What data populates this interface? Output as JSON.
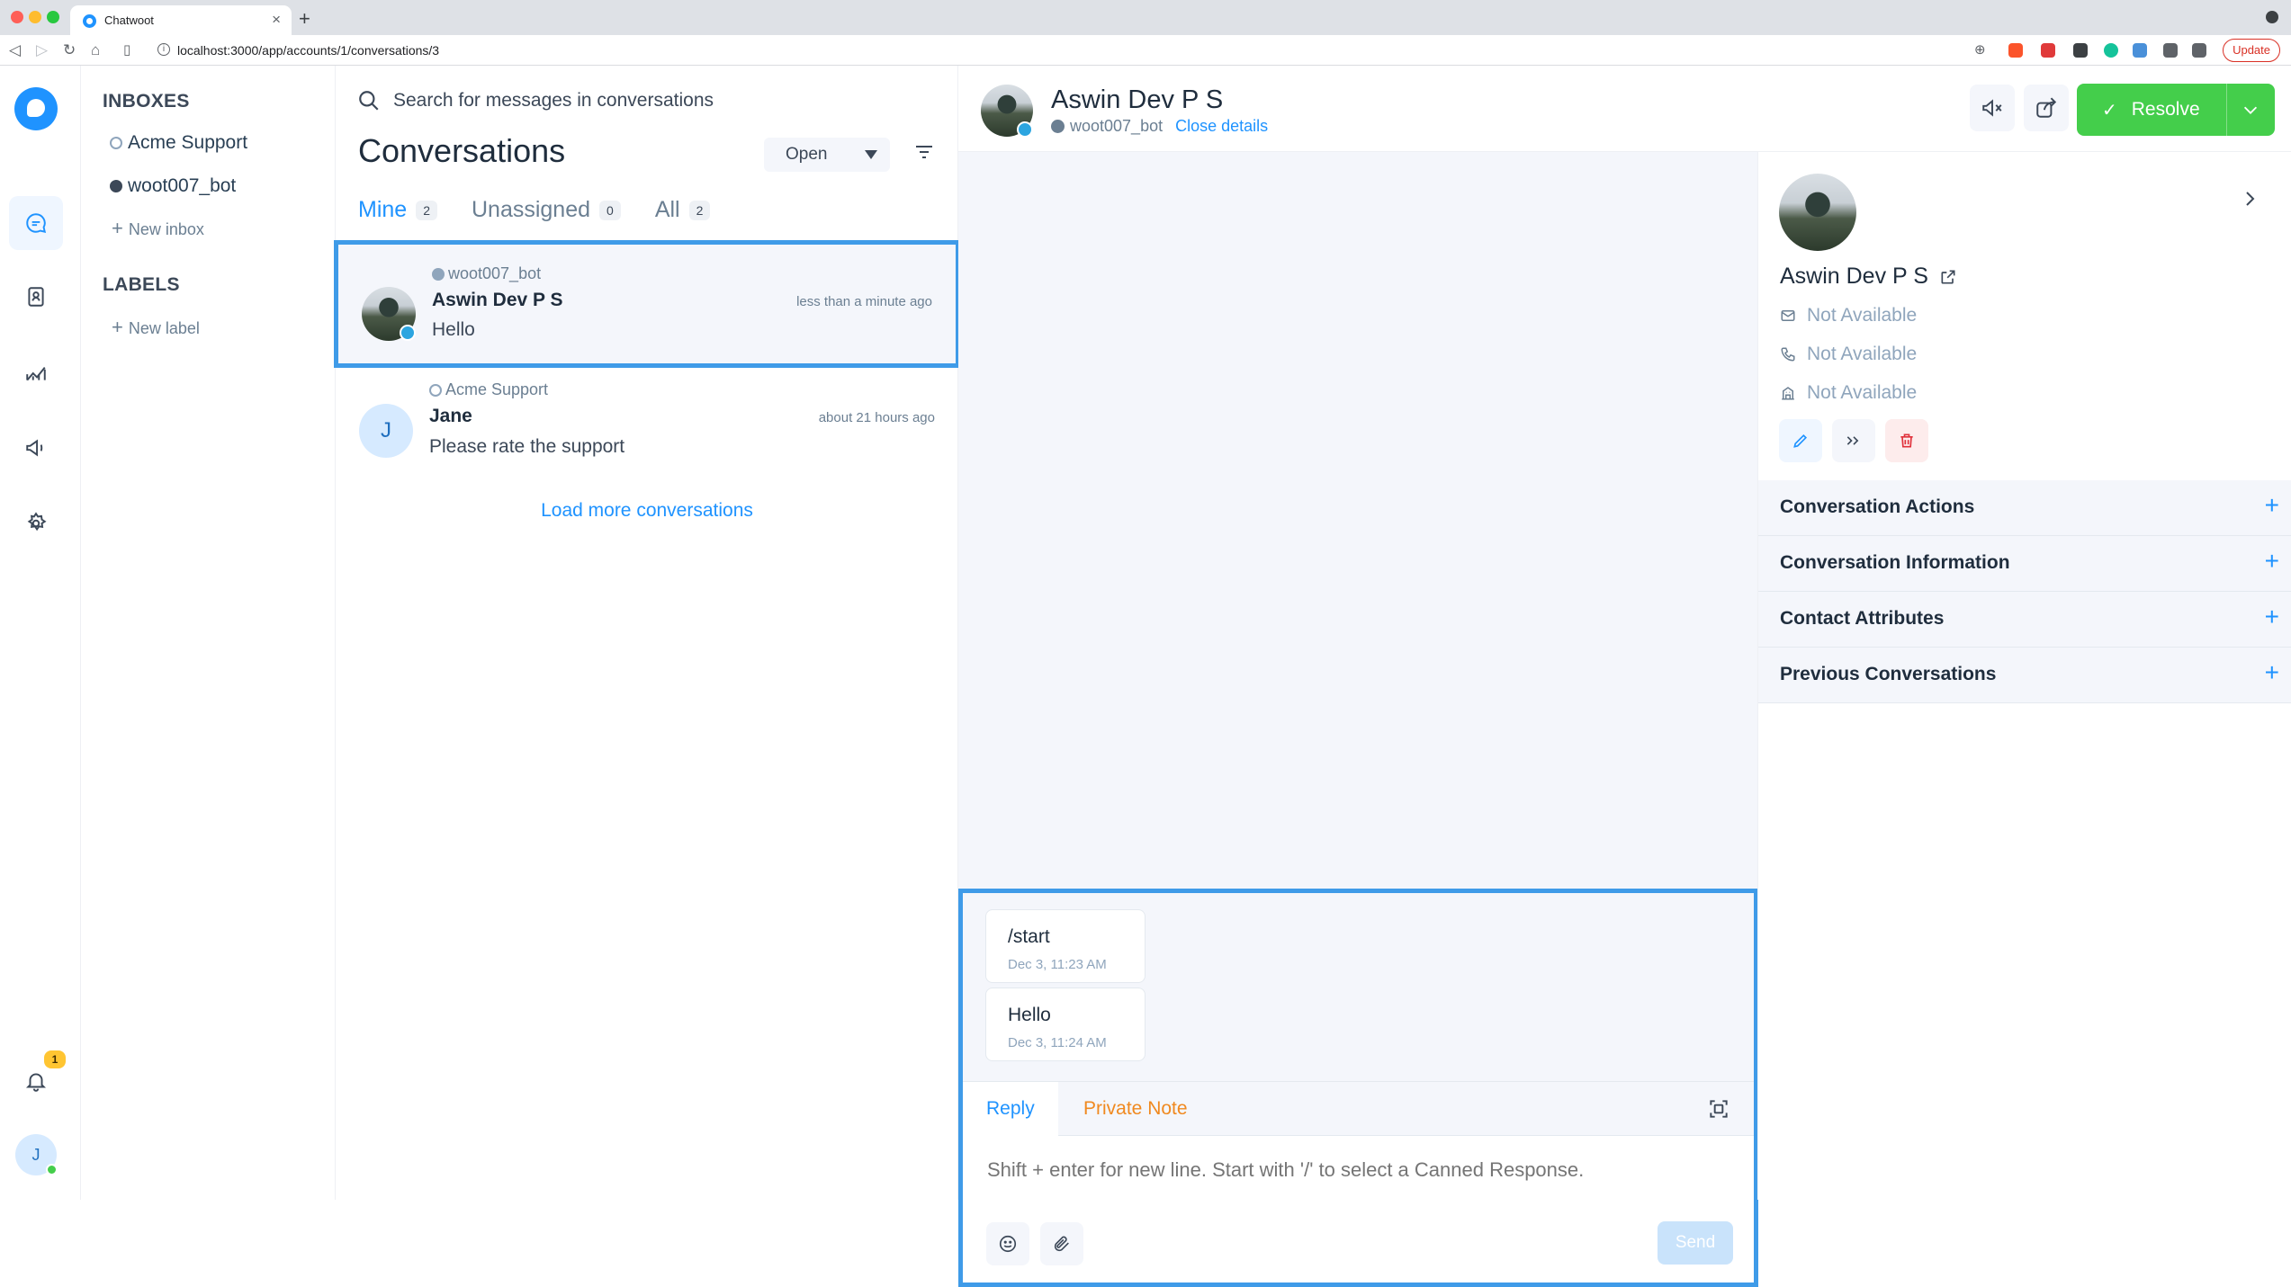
{
  "browser": {
    "tab_title": "Chatwoot",
    "url": "localhost:3000/app/accounts/1/conversations/3",
    "update_label": "Update"
  },
  "primary_nav": {
    "notification_count": "1",
    "user_initial": "J"
  },
  "secondary_nav": {
    "inboxes_heading": "INBOXES",
    "inboxes": [
      {
        "label": "Acme Support",
        "icon": "globe-icon"
      },
      {
        "label": "woot007_bot",
        "icon": "telegram-icon"
      }
    ],
    "new_inbox": "New inbox",
    "labels_heading": "LABELS",
    "new_label": "New label"
  },
  "conv_list": {
    "search_placeholder": "Search for messages in conversations",
    "title": "Conversations",
    "status_filter": "Open",
    "tabs": [
      {
        "label": "Mine",
        "count": "2",
        "active": true
      },
      {
        "label": "Unassigned",
        "count": "0",
        "active": false
      },
      {
        "label": "All",
        "count": "2",
        "active": false
      }
    ],
    "conversations": [
      {
        "inbox": "woot007_bot",
        "name": "Aswin Dev P S",
        "message": "Hello",
        "time": "less than a minute ago",
        "selected": true
      },
      {
        "inbox": "Acme Support",
        "name": "Jane",
        "initial": "J",
        "message": "Please rate the support",
        "time": "about 21 hours ago",
        "selected": false
      }
    ],
    "load_more": "Load more conversations"
  },
  "conversation": {
    "contact_name": "Aswin Dev P S",
    "inbox": "woot007_bot",
    "close_details": "Close details",
    "resolve_label": "Resolve",
    "messages": [
      {
        "text": "/start",
        "time": "Dec 3, 11:23 AM"
      },
      {
        "text": "Hello",
        "time": "Dec 3, 11:24 AM"
      }
    ],
    "reply_tab": "Reply",
    "private_note_tab": "Private Note",
    "reply_placeholder": "Shift + enter for new line. Start with '/' to select a Canned Response.",
    "send_label": "Send"
  },
  "contact_panel": {
    "name": "Aswin Dev P S",
    "email": "Not Available",
    "phone": "Not Available",
    "company": "Not Available",
    "sections": [
      "Conversation Actions",
      "Conversation Information",
      "Contact Attributes",
      "Previous Conversations"
    ]
  },
  "colors": {
    "accent": "#1f93ff",
    "resolve": "#44ce4b",
    "highlight_border": "#3f9be8",
    "private_note": "#f0891f"
  }
}
